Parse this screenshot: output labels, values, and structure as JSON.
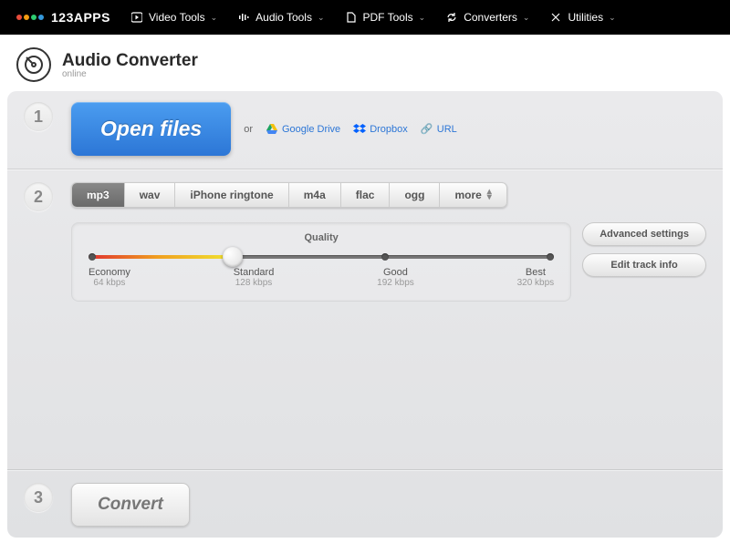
{
  "nav": {
    "brand": "123APPS",
    "items": [
      {
        "label": "Video Tools"
      },
      {
        "label": "Audio Tools"
      },
      {
        "label": "PDF Tools"
      },
      {
        "label": "Converters"
      },
      {
        "label": "Utilities"
      }
    ]
  },
  "header": {
    "title": "Audio Converter",
    "subtitle": "online"
  },
  "step1": {
    "num": "1",
    "open_label": "Open files",
    "or": "or",
    "sources": {
      "gdrive": "Google Drive",
      "dropbox": "Dropbox",
      "url": "URL"
    }
  },
  "step2": {
    "num": "2",
    "formats": [
      "mp3",
      "wav",
      "iPhone ringtone",
      "m4a",
      "flac",
      "ogg",
      "more"
    ],
    "active_format": "mp3",
    "quality_title": "Quality",
    "quality_levels": [
      {
        "name": "Economy",
        "rate": "64 kbps"
      },
      {
        "name": "Standard",
        "rate": "128 kbps"
      },
      {
        "name": "Good",
        "rate": "192 kbps"
      },
      {
        "name": "Best",
        "rate": "320 kbps"
      }
    ],
    "slider_value_index": 1,
    "advanced_label": "Advanced settings",
    "edit_track_label": "Edit track info"
  },
  "step3": {
    "num": "3",
    "convert_label": "Convert"
  },
  "colors": {
    "dot1": "#e74c3c",
    "dot2": "#f39c12",
    "dot3": "#2ecc71",
    "dot4": "#3498db"
  }
}
